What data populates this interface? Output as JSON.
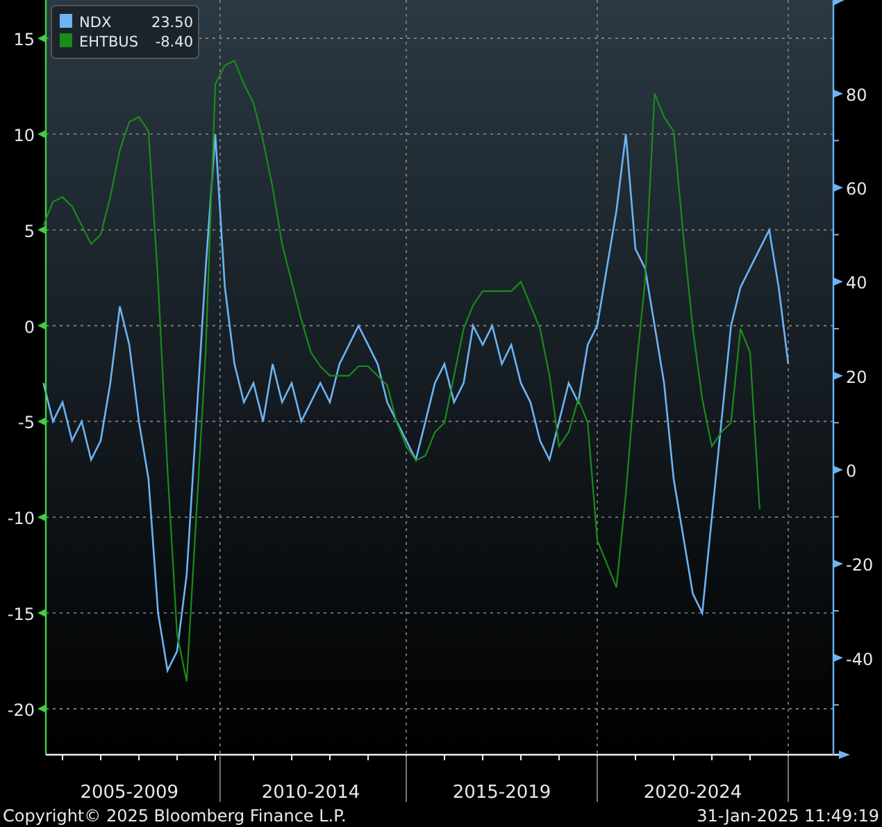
{
  "chart": {
    "left": {
      "chart_data": {
        "type": "line",
        "categories": [
          null,
          null,
          null,
          null,
          null,
          null,
          null,
          null,
          null,
          "2005-2009",
          null,
          null,
          null,
          null,
          null,
          null,
          null,
          null,
          null,
          null,
          null,
          null,
          null,
          null,
          null,
          null,
          null,
          null,
          "2010-2014",
          null,
          null,
          null,
          null,
          null,
          null,
          null,
          null,
          null,
          null,
          null,
          null,
          null,
          null,
          null,
          null,
          null,
          null,
          null,
          "2015-2019",
          null,
          null,
          null,
          null,
          null,
          null,
          null,
          null,
          null,
          null,
          null,
          null,
          null,
          null,
          null,
          null,
          null,
          null,
          null,
          "2020-2024",
          null,
          null,
          null,
          null,
          null,
          null,
          null,
          null,
          null,
          null
        ],
        "ylim": [
          -22.4,
          17
        ],
        "grid": true,
        "yticks": [
          15,
          10,
          5,
          0,
          -5,
          -10,
          -15,
          -20
        ],
        "series": [
          {
            "name": "NDX",
            "color": "#6cb4f4",
            "values": [
              -3,
              -5,
              -4,
              -6,
              -5,
              -7,
              -6,
              -3,
              1,
              -1,
              -5,
              -8,
              -15,
              -18,
              -17,
              -13,
              -5,
              3,
              10,
              2,
              -2,
              -4,
              -3,
              -5,
              -2,
              -4,
              -3,
              -5,
              -4,
              -3,
              -4,
              -2,
              -1,
              0,
              -1,
              -2,
              -4,
              -5,
              -6,
              -7,
              -5,
              -3,
              -2,
              -4,
              -3,
              0,
              -1,
              0,
              -2,
              -1,
              -3,
              -4,
              -6,
              -7,
              -5,
              -3,
              -4,
              -1,
              0,
              3,
              6,
              10,
              4,
              3,
              0,
              -3,
              -8,
              -11,
              -14,
              -15,
              -10,
              -5,
              0,
              2,
              3,
              4,
              5,
              2,
              -2
            ]
          }
        ]
      }
    },
    "right": {
      "chart_data": {
        "type": "line",
        "categories": [
          null,
          null,
          null,
          null,
          null,
          null,
          null,
          null,
          null,
          null,
          null,
          null,
          null,
          null,
          null,
          null,
          null,
          null,
          null,
          null,
          null,
          null,
          null,
          null,
          null,
          null,
          null,
          null,
          null,
          null,
          null,
          null,
          null,
          null,
          null,
          null,
          null,
          null,
          null,
          null,
          null,
          null,
          null,
          null,
          null,
          null,
          null,
          null,
          null,
          null,
          null,
          null,
          null,
          null,
          null,
          null,
          null,
          null,
          null,
          null,
          null,
          null,
          null,
          null,
          null,
          null,
          null,
          null,
          null,
          null,
          null,
          null,
          null,
          null,
          null,
          null
        ],
        "ylim": [
          -60.6,
          99.9
        ],
        "yticks": [
          80,
          60,
          40,
          20,
          0,
          -20,
          -40
        ],
        "series": [
          {
            "name": "EHTBUS",
            "color": "#1a8c1a",
            "values": [
              52,
              57,
              58,
              56,
              52,
              48,
              50,
              58,
              68,
              74,
              75,
              72,
              40,
              0,
              -35,
              -45,
              -10,
              25,
              82,
              86,
              87,
              82,
              78,
              70,
              60,
              48,
              40,
              32,
              25,
              22,
              20,
              20,
              20,
              22,
              22,
              20,
              18,
              10,
              5,
              2,
              3,
              8,
              10,
              20,
              30,
              35,
              38,
              38,
              38,
              38,
              40,
              35,
              30,
              20,
              5,
              8,
              15,
              10,
              -15,
              -20,
              -25,
              -5,
              20,
              40,
              80,
              75,
              72,
              50,
              30,
              15,
              5,
              8,
              10,
              30,
              25,
              -8.4
            ]
          }
        ]
      }
    },
    "legend_values": [
      "23.50",
      "-8.40"
    ]
  },
  "footer": {
    "copyright": "Copyright© 2025 Bloomberg Finance L.P.",
    "timestamp": "31-Jan-2025 11:49:19"
  }
}
